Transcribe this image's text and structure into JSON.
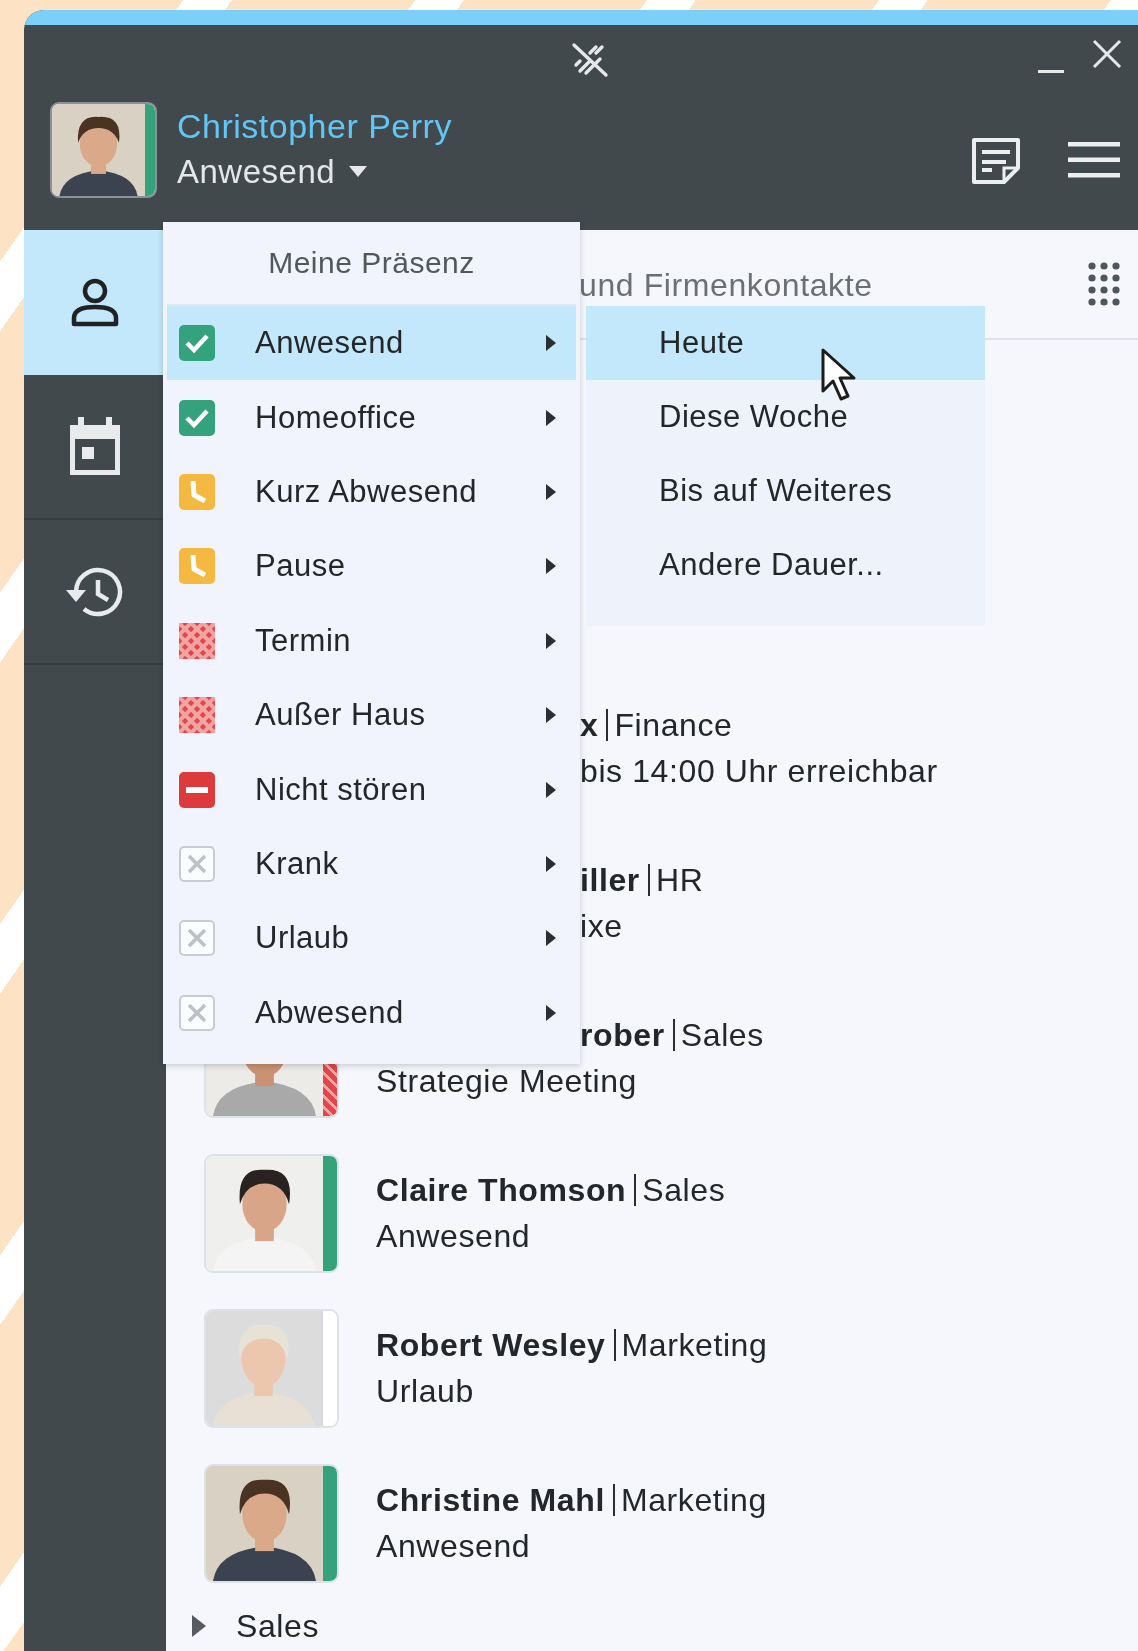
{
  "user": {
    "name": "Christopher Perry",
    "status": "Anwesend",
    "kind": "available"
  },
  "nav": [
    {
      "kind": "person",
      "selected": true
    },
    {
      "kind": "calendar",
      "selected": false
    },
    {
      "kind": "history",
      "selected": false
    }
  ],
  "content_header": {
    "title": "und Firmenkontakte"
  },
  "contacts": [
    {
      "name": "x",
      "department": "Finance",
      "status": "bis 14:00 Uhr erreichbar",
      "name_cut": true,
      "status_cut": true,
      "avatar": false
    },
    {
      "name": "iller",
      "department": "HR",
      "status": "ixe",
      "name_cut": true,
      "status_cut": true,
      "avatar": false
    },
    {
      "name": "rober",
      "department": "Sales",
      "status": "Strategie Meeting",
      "name_cut": true,
      "status_cut": false,
      "avatar": true,
      "kind": "busy"
    },
    {
      "name": "Claire Thomson",
      "department": "Sales",
      "status": "Anwesend",
      "name_cut": false,
      "status_cut": false,
      "avatar": true,
      "kind": "available"
    },
    {
      "name": "Robert Wesley",
      "department": "Marketing",
      "status": "Urlaub",
      "name_cut": false,
      "status_cut": false,
      "avatar": true,
      "kind": "off"
    },
    {
      "name": "Christine Mahl",
      "department": "Marketing",
      "status": "Anwesend",
      "name_cut": false,
      "status_cut": false,
      "avatar": true,
      "kind": "available"
    }
  ],
  "group": {
    "label": "Sales",
    "expanded": false
  },
  "presence_menu": {
    "title": "Meine Präsenz",
    "items": [
      {
        "label": "Anwesend",
        "kind": "check",
        "selected": true
      },
      {
        "label": "Homeoffice",
        "kind": "check",
        "selected": false
      },
      {
        "label": "Kurz Abwesend",
        "kind": "clock",
        "selected": false
      },
      {
        "label": "Pause",
        "kind": "clock",
        "selected": false
      },
      {
        "label": "Termin",
        "kind": "checkered",
        "selected": false
      },
      {
        "label": "Außer Haus",
        "kind": "checkered",
        "selected": false
      },
      {
        "label": "Nicht stören",
        "kind": "dnd",
        "selected": false
      },
      {
        "label": "Krank",
        "kind": "cross",
        "selected": false
      },
      {
        "label": "Urlaub",
        "kind": "cross",
        "selected": false
      },
      {
        "label": "Abwesend",
        "kind": "cross",
        "selected": false
      }
    ]
  },
  "duration_menu": {
    "items": [
      {
        "label": "Heute",
        "selected": true
      },
      {
        "label": "Diese Woche",
        "selected": false
      },
      {
        "label": "Bis auf Weiteres",
        "selected": false
      },
      {
        "label": "Andere Dauer...",
        "selected": false
      }
    ]
  }
}
